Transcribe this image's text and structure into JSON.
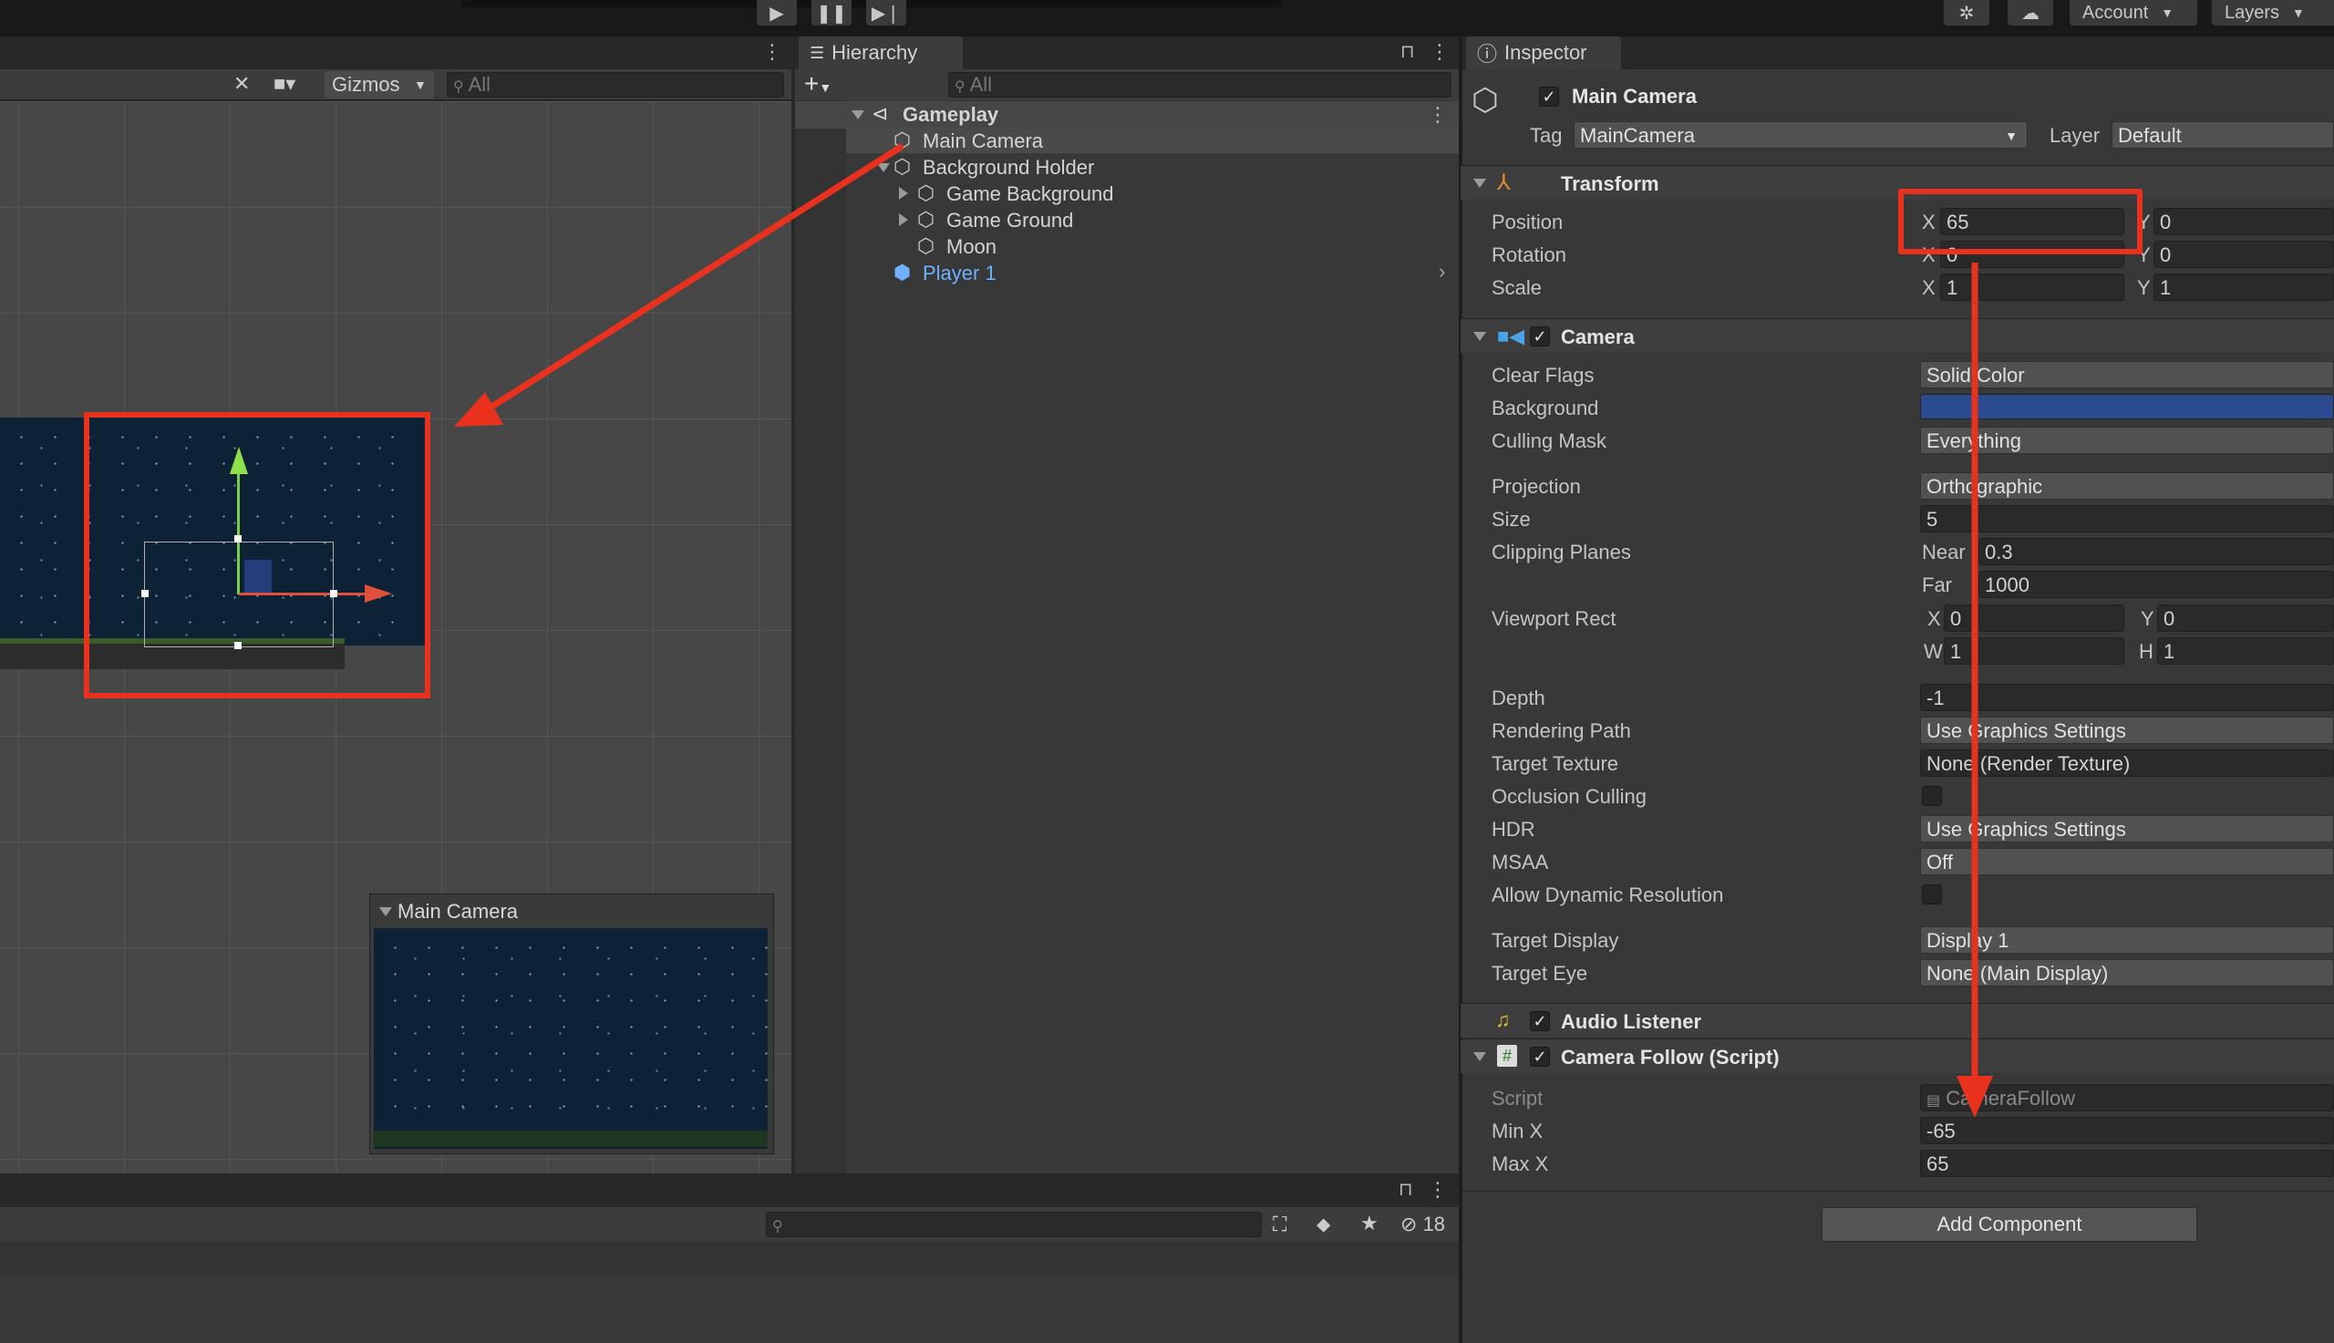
{
  "toolbar": {
    "account_label": "Account",
    "layers_label": "Layers"
  },
  "scene": {
    "gizmos_label": "Gizmos",
    "search_placeholder": "All",
    "camera_preview_title": "Main Camera"
  },
  "hierarchy": {
    "tab_label": "Hierarchy",
    "search_placeholder": "All",
    "scene_name": "Gameplay",
    "items": [
      {
        "label": "Main Camera"
      },
      {
        "label": "Background Holder"
      },
      {
        "label": "Game Background"
      },
      {
        "label": "Game Ground"
      },
      {
        "label": "Moon"
      },
      {
        "label": "Player 1"
      }
    ]
  },
  "project": {
    "hidden_count": "18"
  },
  "inspector": {
    "tab_label": "Inspector",
    "object_name": "Main Camera",
    "tag_label": "Tag",
    "tag_value": "MainCamera",
    "layer_label": "Layer",
    "layer_value": "Default",
    "transform": {
      "title": "Transform",
      "position_label": "Position",
      "rotation_label": "Rotation",
      "scale_label": "Scale",
      "x_axis": "X",
      "y_axis": "Y",
      "position_x": "65",
      "position_y": "0",
      "rotation_x": "0",
      "rotation_y": "0",
      "scale_x": "1",
      "scale_y": "1"
    },
    "camera": {
      "title": "Camera",
      "clear_flags_label": "Clear Flags",
      "clear_flags_value": "Solid Color",
      "background_label": "Background",
      "background_color": "#2b4a8f",
      "culling_mask_label": "Culling Mask",
      "culling_mask_value": "Everything",
      "projection_label": "Projection",
      "projection_value": "Orthographic",
      "size_label": "Size",
      "size_value": "5",
      "clipping_label": "Clipping Planes",
      "near_label": "Near",
      "near_value": "0.3",
      "far_label": "Far",
      "far_value": "1000",
      "viewport_label": "Viewport Rect",
      "vp_x_label": "X",
      "vp_x": "0",
      "vp_y_label": "Y",
      "vp_y": "0",
      "vp_w_label": "W",
      "vp_w": "1",
      "vp_h_label": "H",
      "vp_h": "1",
      "depth_label": "Depth",
      "depth_value": "-1",
      "rendering_path_label": "Rendering Path",
      "rendering_path_value": "Use Graphics Settings",
      "target_texture_label": "Target Texture",
      "target_texture_value": "None (Render Texture)",
      "occlusion_label": "Occlusion Culling",
      "hdr_label": "HDR",
      "hdr_value": "Use Graphics Settings",
      "msaa_label": "MSAA",
      "msaa_value": "Off",
      "dynamic_res_label": "Allow Dynamic Resolution",
      "target_display_label": "Target Display",
      "target_display_value": "Display 1",
      "target_eye_label": "Target Eye",
      "target_eye_value": "None (Main Display)"
    },
    "audio_listener": {
      "title": "Audio Listener"
    },
    "camera_follow": {
      "title": "Camera Follow (Script)",
      "script_label": "Script",
      "script_value": "CameraFollow",
      "min_x_label": "Min X",
      "min_x_value": "-65",
      "max_x_label": "Max X",
      "max_x_value": "65"
    },
    "add_component_label": "Add Component"
  },
  "colors": {
    "annotation_red": "#e8321e",
    "selection_blue": "#2c5d87",
    "player_blue": "#6fb1ff"
  }
}
